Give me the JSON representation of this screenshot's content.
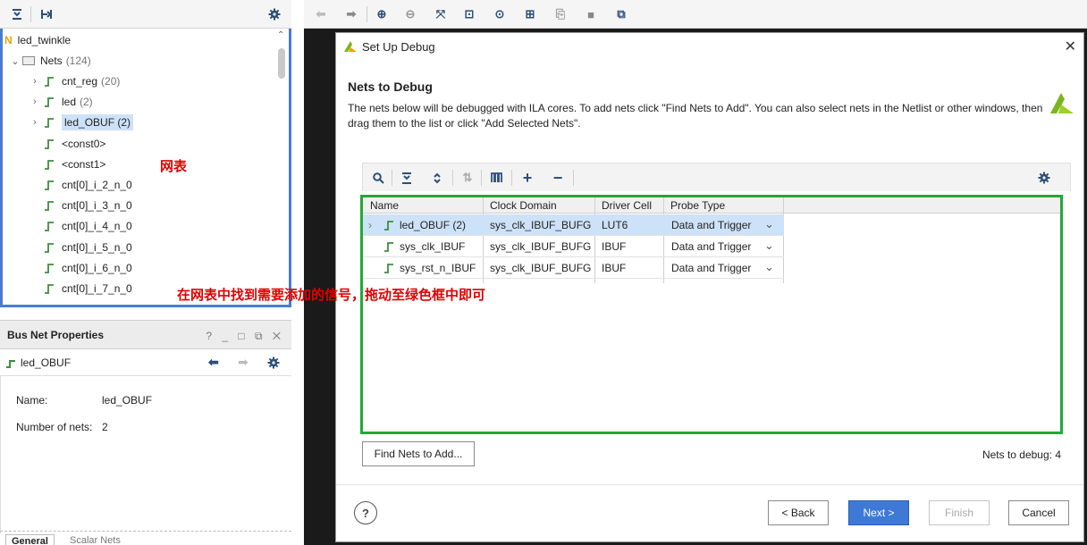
{
  "netlist": {
    "root": "led_twinkle",
    "root_badge": "N",
    "nets_label": "Nets",
    "nets_count": "(124)",
    "items": [
      {
        "label": "cnt_reg",
        "count": "(20)",
        "expandable": true
      },
      {
        "label": "led",
        "count": "(2)",
        "expandable": true
      },
      {
        "label": "led_OBUF (2)",
        "count": "",
        "expandable": true,
        "selected": true
      },
      {
        "label": "<const0>",
        "count": "",
        "expandable": false
      },
      {
        "label": "<const1>",
        "count": "",
        "expandable": false
      },
      {
        "label": "cnt[0]_i_2_n_0",
        "count": "",
        "expandable": false
      },
      {
        "label": "cnt[0]_i_3_n_0",
        "count": "",
        "expandable": false
      },
      {
        "label": "cnt[0]_i_4_n_0",
        "count": "",
        "expandable": false
      },
      {
        "label": "cnt[0]_i_5_n_0",
        "count": "",
        "expandable": false
      },
      {
        "label": "cnt[0]_i_6_n_0",
        "count": "",
        "expandable": false
      },
      {
        "label": "cnt[0]_i_7_n_0",
        "count": "",
        "expandable": false
      }
    ]
  },
  "annotations": {
    "netlist_note": "网表",
    "drag_note": "在网表中找到需要添加的信号，拖动至绿色框中即可"
  },
  "properties": {
    "title": "Bus Net Properties",
    "window_controls": "? _ □ ⧉ ✕",
    "object": "led_OBUF",
    "name_label": "Name:",
    "name_value": "led_OBUF",
    "nets_label": "Number of nets:",
    "nets_value": "2",
    "tabs": [
      "General",
      "Scalar Nets"
    ]
  },
  "dialog": {
    "title": "Set Up Debug",
    "heading": "Nets to Debug",
    "description": "The nets below will be debugged with ILA cores. To add nets click \"Find Nets to Add\". You can also select nets in the Netlist or other windows, then drag them to the list or click \"Add Selected Nets\".",
    "columns": [
      "Name",
      "Clock Domain",
      "Driver Cell",
      "Probe Type"
    ],
    "rows": [
      {
        "name": "led_OBUF (2)",
        "clock": "sys_clk_IBUF_BUFG",
        "driver": "LUT6",
        "probe": "Data and Trigger",
        "selected": true,
        "expandable": true
      },
      {
        "name": "sys_clk_IBUF",
        "clock": "sys_clk_IBUF_BUFG",
        "driver": "IBUF",
        "probe": "Data and Trigger",
        "selected": false,
        "expandable": false
      },
      {
        "name": "sys_rst_n_IBUF",
        "clock": "sys_clk_IBUF_BUFG",
        "driver": "IBUF",
        "probe": "Data and Trigger",
        "selected": false,
        "expandable": false
      }
    ],
    "find_button": "Find Nets to Add...",
    "nets_to_debug": "Nets to debug: 4",
    "help": "?",
    "back": "< Back",
    "next": "Next >",
    "finish": "Finish",
    "cancel": "Cancel"
  },
  "colors": {
    "selection": "#cde2f8",
    "green_box": "#22a83a",
    "primary_button": "#3f79d6",
    "annotation_red": "#e00000",
    "panel_border_blue": "#4a7cd1"
  }
}
